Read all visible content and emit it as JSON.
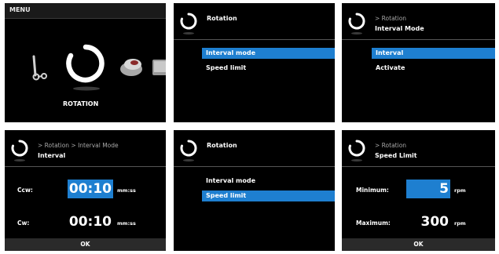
{
  "panel_menu": {
    "title": "MENU",
    "icons": [
      "stir-icon",
      "rotation-icon",
      "shaker-icon",
      "dish-icon"
    ],
    "selected_label": "ROTATION"
  },
  "panel_rotation_1": {
    "title": "Rotation",
    "items": [
      {
        "label": "Interval  mode",
        "selected": true
      },
      {
        "label": "Speed  limit",
        "selected": false
      }
    ]
  },
  "panel_interval_mode": {
    "crumb": "> Rotation",
    "subtitle": "Interval Mode",
    "items": [
      {
        "label": "Interval",
        "selected": true
      },
      {
        "label": "Activate",
        "selected": false
      }
    ]
  },
  "panel_interval": {
    "crumb": "> Rotation > Interval Mode",
    "subtitle": "Interval",
    "rows": [
      {
        "label": "Ccw:",
        "value": "00:10",
        "unit": "mm:ss",
        "selected": true
      },
      {
        "label": "Cw:",
        "value": "00:10",
        "unit": "mm:ss",
        "selected": false
      }
    ],
    "footer": "OK"
  },
  "panel_rotation_2": {
    "title": "Rotation",
    "items": [
      {
        "label": "Interval mode",
        "selected": false
      },
      {
        "label": "Speed  limit",
        "selected": true
      }
    ]
  },
  "panel_speed_limit": {
    "crumb": "> Rotation",
    "subtitle": "Speed Limit",
    "rows": [
      {
        "label": "Minimum:",
        "value": "5",
        "unit": "rpm",
        "selected": true
      },
      {
        "label": "Maximum:",
        "value": "300",
        "unit": "rpm",
        "selected": false
      }
    ],
    "footer": "OK"
  },
  "colors": {
    "highlight": "#1e7fd0",
    "background": "#000000",
    "footer": "#2a2a2a"
  }
}
